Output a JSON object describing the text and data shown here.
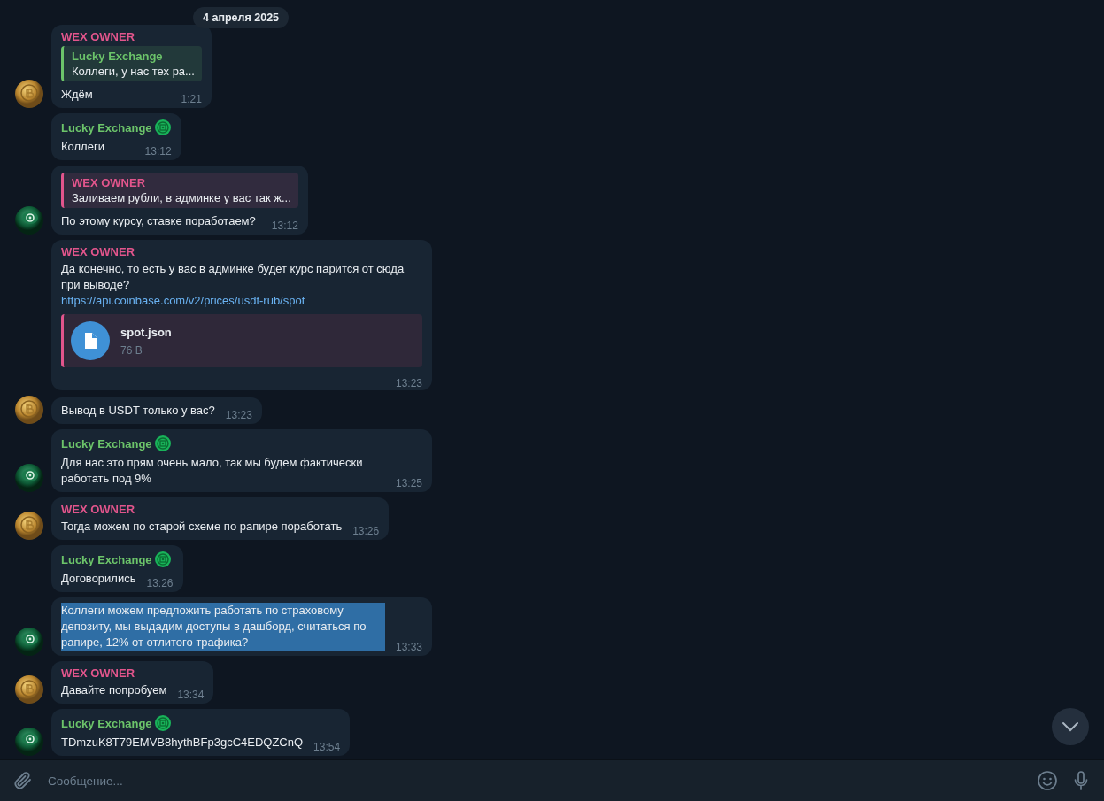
{
  "date_pill": "4 апреля 2025",
  "messages": [
    {
      "sender": {
        "name": "WEX OWNER",
        "color": "#e2558c",
        "badge": false
      },
      "reply": {
        "author": "Lucky Exchange",
        "color": "#6cc46a",
        "text": "Коллеги, у нас тех ра..."
      },
      "text": "Ждём",
      "time": "1:21",
      "avatar": {
        "kind": "coin"
      },
      "highlighted": false
    },
    {
      "sender": {
        "name": "Lucky Exchange",
        "color": "#6cc46a",
        "badge": true
      },
      "text": "Коллеги",
      "time": "13:12",
      "highlighted": false
    },
    {
      "reply": {
        "author": "WEX OWNER",
        "color": "#e2558c",
        "text": "Заливаем рубли, в админке у вас так ж..."
      },
      "text": "По этому курсу, ставке поработаем?",
      "time": "13:12",
      "avatar": {
        "kind": "token"
      },
      "highlighted": false
    },
    {
      "sender": {
        "name": "WEX OWNER",
        "color": "#e2558c",
        "badge": false
      },
      "text": "Да конечно, то есть у вас в админке будет курс парится от сюда при выводе?",
      "link": "https://api.coinbase.com/v2/prices/usdt-rub/spot",
      "file": {
        "name": "spot.json",
        "size": "76 B"
      },
      "time": "13:23",
      "highlighted": false
    },
    {
      "text": "Вывод в USDT только у вас?",
      "time": "13:23",
      "avatar": {
        "kind": "coin"
      },
      "highlighted": false
    },
    {
      "sender": {
        "name": "Lucky Exchange",
        "color": "#6cc46a",
        "badge": true
      },
      "text": "Для нас это прям очень мало, так мы будем фактически работать под 9%",
      "time": "13:25",
      "avatar": {
        "kind": "token"
      },
      "highlighted": false
    },
    {
      "sender": {
        "name": "WEX OWNER",
        "color": "#e2558c",
        "badge": false
      },
      "text": "Тогда можем по старой схеме по рапире поработать",
      "time": "13:26",
      "avatar": {
        "kind": "coin"
      },
      "highlighted": false
    },
    {
      "sender": {
        "name": "Lucky Exchange",
        "color": "#6cc46a",
        "badge": true
      },
      "text": "Договорились",
      "time": "13:26",
      "highlighted": false
    },
    {
      "text": "Коллеги можем предложить работать по страховому депозиту, мы выдадим доступы в дашборд, считаться по рапире, 12% от отлитого трафика?",
      "time": "13:33",
      "avatar": {
        "kind": "token"
      },
      "highlighted": true
    },
    {
      "sender": {
        "name": "WEX OWNER",
        "color": "#e2558c",
        "badge": false
      },
      "text": "Давайте попробуем",
      "time": "13:34",
      "avatar": {
        "kind": "coin"
      },
      "highlighted": false
    },
    {
      "sender": {
        "name": "Lucky Exchange",
        "color": "#6cc46a",
        "badge": true
      },
      "text": "TDmzuK8T79EMVB8hythBFp3gcC4EDQZCnQ",
      "time": "13:54",
      "avatar": {
        "kind": "token"
      },
      "highlighted": false
    }
  ],
  "composer": {
    "placeholder": "Сообщение..."
  }
}
